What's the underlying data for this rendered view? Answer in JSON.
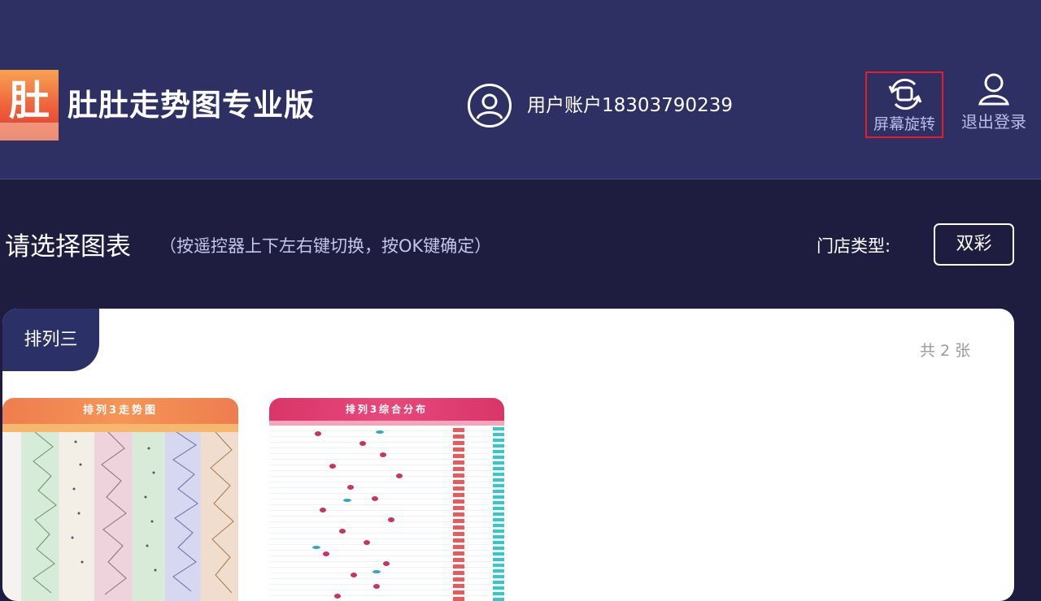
{
  "header": {
    "logo_char": "肚",
    "app_title": "肚肚走势图专业版",
    "account_label": "用户账户18303790239",
    "rotate_label": "屏幕旋转",
    "logout_label": "退出登录"
  },
  "section": {
    "title": "请选择图表",
    "hint": "（按遥控器上下左右键切换，按OK键确定）",
    "store_label": "门店类型:",
    "store_value": "双彩"
  },
  "panel": {
    "tab_label": "排列三",
    "count": "共 2 张",
    "thumbnails": [
      {
        "title": "排列3走势图",
        "accent": "#ee7d4f"
      },
      {
        "title": "排列3综合分布",
        "accent": "#d9356a"
      }
    ]
  },
  "colors": {
    "header_bg": "#2e2f62",
    "page_bg": "#1e1d3f",
    "tab_bg": "#2b3167",
    "focus_border": "#e0202a"
  }
}
